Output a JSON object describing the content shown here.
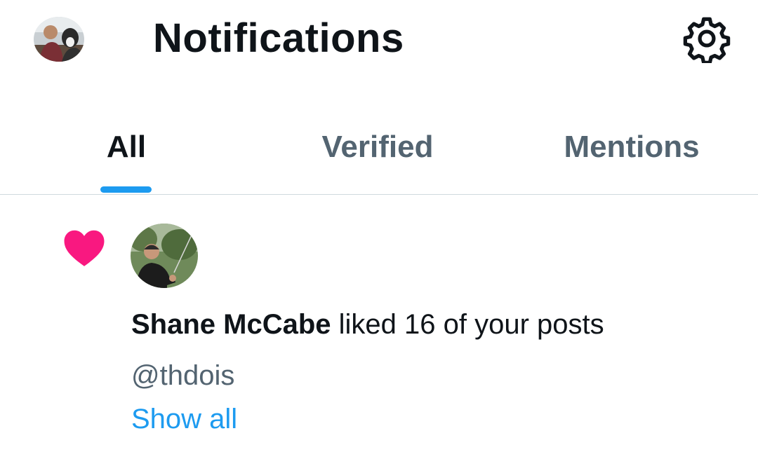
{
  "header": {
    "title": "Notifications",
    "avatar_icon": "user-avatar",
    "settings_icon": "gear-icon"
  },
  "tabs": [
    {
      "label": "All",
      "active": true
    },
    {
      "label": "Verified",
      "active": false
    },
    {
      "label": "Mentions",
      "active": false
    }
  ],
  "notification": {
    "type_icon": "heart-icon",
    "icon_color": "#f91880",
    "user_name": "Shane McCabe",
    "action_text": " liked 16 of your posts",
    "handle": "@thdois",
    "show_all_label": "Show all"
  },
  "colors": {
    "accent": "#1d9bf0",
    "like": "#f91880",
    "text_primary": "#0f1419",
    "text_secondary": "#536471"
  }
}
